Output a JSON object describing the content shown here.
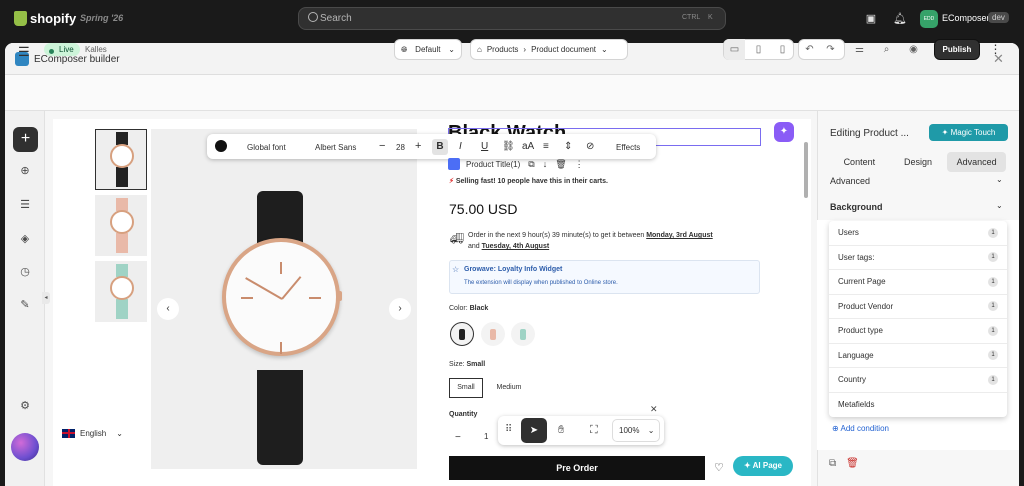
{
  "shopify": {
    "logo_text": "shopify",
    "season": "Spring '26",
    "search_placeholder": "Search",
    "shortcut_key1": "CTRL",
    "shortcut_key2": "K",
    "user_initials": "EDD",
    "user_name": "EComposer",
    "user_tag": "dev"
  },
  "window": {
    "title": "EComposer builder",
    "close": "✕"
  },
  "toolbar": {
    "status": "Live",
    "theme": "Kalles",
    "layout": "Default",
    "breadcrumb_1": "Products",
    "breadcrumb_2": "Product document",
    "publish": "Publish"
  },
  "product": {
    "title": "Black Watch",
    "title_chip": "Product Title(1)",
    "selling_fast": "Selling fast! 10 people have this in their carts.",
    "price": "75.00 USD",
    "shipping_text_prefix": "Order in the next 9 hour(s) 39 minute(s) to get it between ",
    "shipping_date1": "Monday, 3rd August",
    "shipping_and": " and ",
    "shipping_date2": "Tuesday, 4th August",
    "loyalty_title": "Growave: Loyalty Info Widget",
    "loyalty_sub": "The extension will display when published to Online store.",
    "color_label": "Color: ",
    "color_value": "Black",
    "size_label": "Size: ",
    "size_value": "Small",
    "sizes": [
      "Small",
      "Medium"
    ],
    "quantity_label": "Quantity",
    "quantity_value": "1",
    "pre_order": "Pre Order",
    "ai_page": "AI Page",
    "language": "English"
  },
  "text_toolbar": {
    "font_label": "Global font",
    "font_name": "Albert Sans",
    "font_size": "28",
    "effects": "Effects",
    "bold": "B",
    "italic": "I",
    "underline": "U",
    "case": "aA"
  },
  "canvas_toolbar": {
    "zoom": "100%"
  },
  "panel": {
    "title": "Editing Product ...",
    "magic_touch": "Magic Touch",
    "tabs": [
      "Content",
      "Design",
      "Advanced"
    ],
    "advanced_label": "Advanced",
    "background_label": "Background",
    "conditions": [
      {
        "label": "Users",
        "count": "1"
      },
      {
        "label": "User tags:",
        "count": "1"
      },
      {
        "label": "Current Page",
        "count": "1"
      },
      {
        "label": "Product Vendor",
        "count": "1"
      },
      {
        "label": "Product type",
        "count": "1"
      },
      {
        "label": "Language",
        "count": "1"
      },
      {
        "label": "Country",
        "count": "1"
      },
      {
        "label": "Metafields",
        "count": ""
      }
    ],
    "add_condition": "Add condition"
  }
}
